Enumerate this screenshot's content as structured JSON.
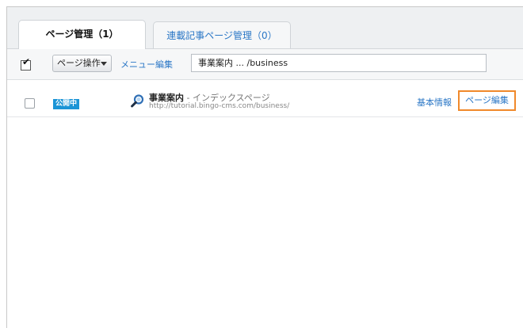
{
  "tabs": [
    {
      "label": "ページ管理（1）",
      "active": true
    },
    {
      "label": "連載記事ページ管理（0）",
      "active": false
    }
  ],
  "toolbar": {
    "dropdown_label": "ページ操作",
    "menu_edit_label": "メニュー編集",
    "path_value": "事業案内 ... /business"
  },
  "row": {
    "status": "公開中",
    "title_main": "事業案内",
    "title_sep": " - ",
    "title_sub": "インデックスページ",
    "url": "http://tutorial.bingo-cms.com/business/",
    "basic_info_label": "基本情報",
    "page_edit_label": "ページ編集"
  },
  "colors": {
    "accent": "#2b77c6",
    "badge": "#1a94d6",
    "highlight": "#f0892b"
  }
}
